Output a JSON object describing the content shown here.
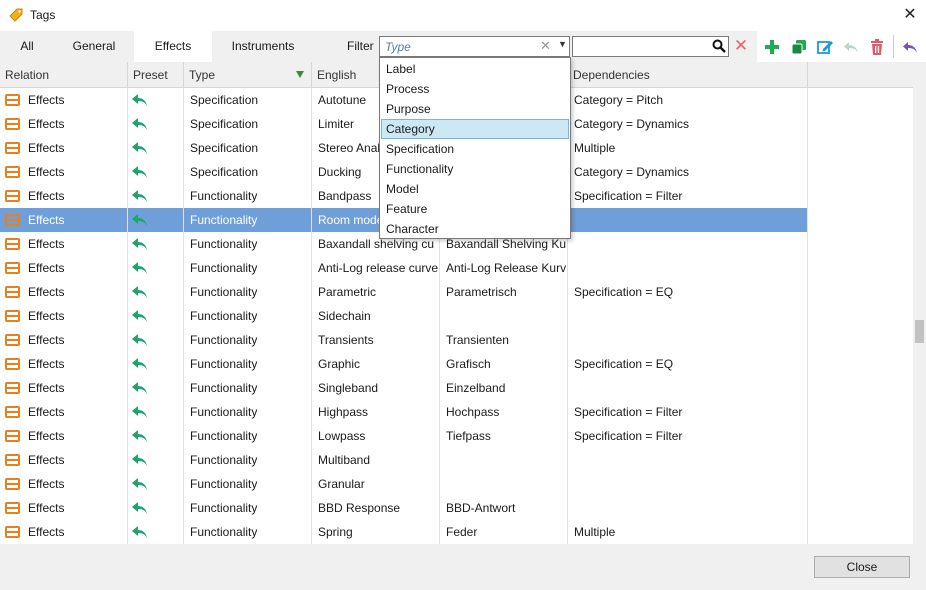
{
  "window": {
    "title": "Tags",
    "close_glyph": "✕"
  },
  "tabs": [
    {
      "label": "All"
    },
    {
      "label": "General"
    },
    {
      "label": "Effects",
      "active": true
    },
    {
      "label": "Instruments"
    }
  ],
  "filter": {
    "label": "Filter",
    "placeholder": "Type",
    "options": [
      "Label",
      "Process",
      "Purpose",
      "Category",
      "Specification",
      "Functionality",
      "Model",
      "Feature",
      "Character"
    ],
    "highlighted": "Category"
  },
  "search": {
    "value": ""
  },
  "toolbar": {
    "icons": [
      "add-icon",
      "duplicate-icon",
      "edit-icon",
      "undo-icon",
      "delete-icon",
      "revert-icon"
    ],
    "colors": {
      "add": "#1fab52",
      "edit": "#1a9bd9",
      "delete": "#e05a6a",
      "revert": "#7b52c4",
      "disabled": "#b8d8c8"
    }
  },
  "columns": [
    "Relation",
    "Preset",
    "Type",
    "English",
    "",
    "Dependencies"
  ],
  "rows": [
    {
      "relation": "Effects",
      "type": "Specification",
      "english": "Autotune",
      "german": "",
      "deps": "Category = Pitch"
    },
    {
      "relation": "Effects",
      "type": "Specification",
      "english": "Limiter",
      "german": "",
      "deps": "Category = Dynamics"
    },
    {
      "relation": "Effects",
      "type": "Specification",
      "english": "Stereo Anal",
      "german": "",
      "deps": "Multiple"
    },
    {
      "relation": "Effects",
      "type": "Specification",
      "english": "Ducking",
      "german": "",
      "deps": "Category = Dynamics"
    },
    {
      "relation": "Effects",
      "type": "Functionality",
      "english": "Bandpass",
      "german": "",
      "deps": "Specification = Filter"
    },
    {
      "relation": "Effects",
      "type": "Functionality",
      "english": "Room mode",
      "german": "",
      "deps": "",
      "selected": true
    },
    {
      "relation": "Effects",
      "type": "Functionality",
      "english": "Baxandall shelving cu",
      "german": "Baxandall Shelving Ku",
      "deps": ""
    },
    {
      "relation": "Effects",
      "type": "Functionality",
      "english": "Anti-Log release curve",
      "german": "Anti-Log Release Kurv",
      "deps": ""
    },
    {
      "relation": "Effects",
      "type": "Functionality",
      "english": "Parametric",
      "german": "Parametrisch",
      "deps": "Specification = EQ"
    },
    {
      "relation": "Effects",
      "type": "Functionality",
      "english": "Sidechain",
      "german": "",
      "deps": ""
    },
    {
      "relation": "Effects",
      "type": "Functionality",
      "english": "Transients",
      "german": "Transienten",
      "deps": ""
    },
    {
      "relation": "Effects",
      "type": "Functionality",
      "english": "Graphic",
      "german": "Grafisch",
      "deps": "Specification = EQ"
    },
    {
      "relation": "Effects",
      "type": "Functionality",
      "english": "Singleband",
      "german": "Einzelband",
      "deps": ""
    },
    {
      "relation": "Effects",
      "type": "Functionality",
      "english": "Highpass",
      "german": "Hochpass",
      "deps": "Specification = Filter"
    },
    {
      "relation": "Effects",
      "type": "Functionality",
      "english": "Lowpass",
      "german": "Tiefpass",
      "deps": "Specification = Filter"
    },
    {
      "relation": "Effects",
      "type": "Functionality",
      "english": "Multiband",
      "german": "",
      "deps": ""
    },
    {
      "relation": "Effects",
      "type": "Functionality",
      "english": "Granular",
      "german": "",
      "deps": ""
    },
    {
      "relation": "Effects",
      "type": "Functionality",
      "english": "BBD Response",
      "german": "BBD-Antwort",
      "deps": ""
    },
    {
      "relation": "Effects",
      "type": "Functionality",
      "english": "Spring",
      "german": "Feder",
      "deps": "Multiple"
    }
  ],
  "footer": {
    "close_label": "Close"
  },
  "colors": {
    "selected_row": "#6f9fd8",
    "relation_icon": "#e8801e",
    "preset_icon": "#1fa46b",
    "tag_icon": "#f2b01e"
  }
}
